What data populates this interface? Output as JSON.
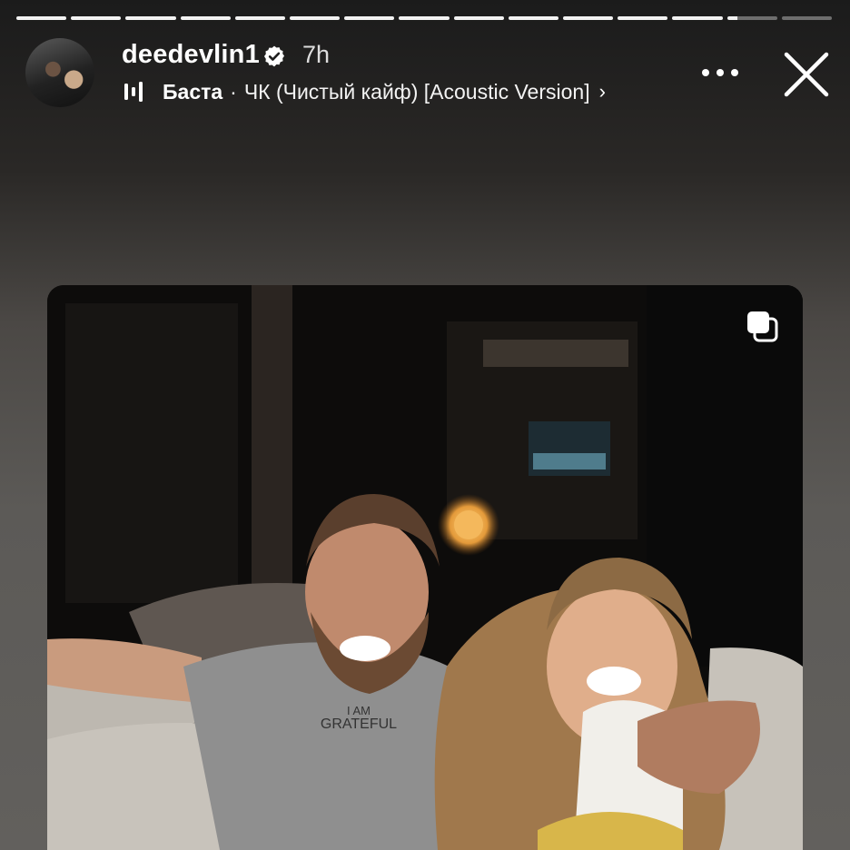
{
  "story": {
    "segments_total": 15,
    "segments_completed": 13,
    "current_segment_progress": 0.2
  },
  "header": {
    "username": "deedevlin1",
    "time_ago": "7h",
    "music": {
      "artist": "Баста",
      "separator": "·",
      "song": "ЧК (Чистый кайф) [Acoustic Version]",
      "chevron": "›"
    },
    "icons": {
      "verified": "verified-badge-icon",
      "more": "more-dots-icon",
      "close": "close-icon",
      "music": "music-bars-icon"
    }
  },
  "post": {
    "shirt_text_line1": "I AM",
    "shirt_text_line2": "GRATEFUL",
    "icons": {
      "carousel": "carousel-multi-icon"
    }
  },
  "colors": {
    "progress_active": "#f2f2f2",
    "progress_inactive": "#6e6e6e"
  }
}
